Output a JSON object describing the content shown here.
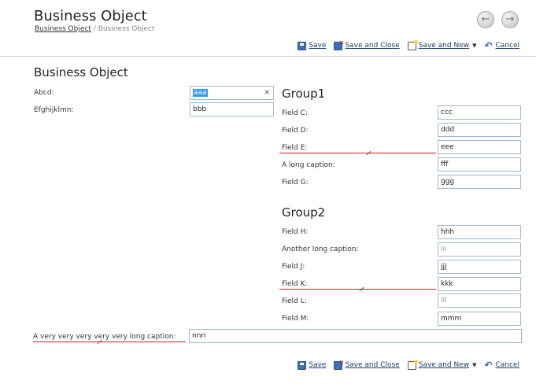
{
  "header": {
    "title": "Business Object",
    "breadcrumb": {
      "link": "Business Object",
      "separator": "/",
      "current": "Business Object"
    }
  },
  "nav": {
    "back_icon": "arrow-left-circle-icon",
    "forward_icon": "arrow-right-circle-icon"
  },
  "toolbar": {
    "save": "Save",
    "save_close": "Save and Close",
    "save_new": "Save and New",
    "cancel": "Cancel"
  },
  "form": {
    "title": "Business Object",
    "abcd": {
      "label": "Abcd:",
      "value": "aaa"
    },
    "efgh": {
      "label": "Efghijklmn:",
      "value": "bbb"
    },
    "long": {
      "label": "A very very very very very long caption:",
      "value": "nnn"
    }
  },
  "group1": {
    "title": "Group1",
    "fields": [
      {
        "label": "Field C:",
        "value": "ccc"
      },
      {
        "label": "Field D:",
        "value": "ddd"
      },
      {
        "label": "Field E:",
        "value": "eee"
      },
      {
        "label": "A long caption:",
        "value": "fff"
      },
      {
        "label": "Field G:",
        "value": "ggg"
      }
    ]
  },
  "group2": {
    "title": "Group2",
    "fields": [
      {
        "label": "Field H:",
        "value": "hhh"
      },
      {
        "label": "Another long caption:",
        "value": "iii"
      },
      {
        "label": "Field J:",
        "value": "jjj"
      },
      {
        "label": "Field K:",
        "value": "kkk"
      },
      {
        "label": "Field L:",
        "value": "lll"
      },
      {
        "label": "Field M:",
        "value": "mmm"
      }
    ]
  },
  "colors": {
    "error_underline": "#c42121",
    "input_border": "#a3b6cc",
    "selection": "#3399ff",
    "link": "#1a3e66"
  }
}
